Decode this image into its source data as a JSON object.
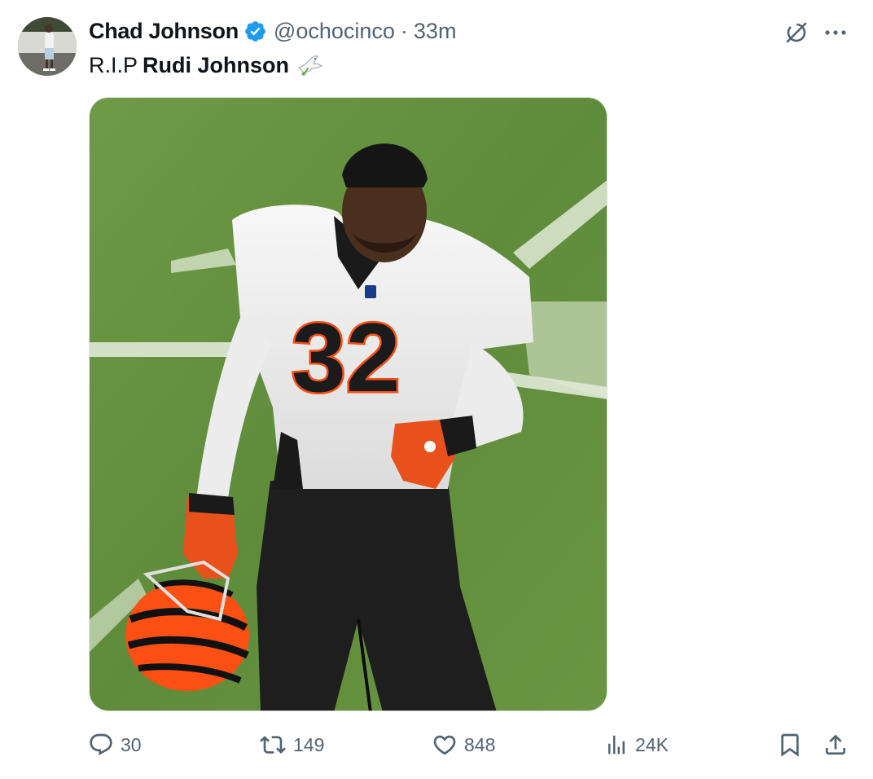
{
  "tweet": {
    "author": {
      "display_name": "Chad Johnson",
      "handle": "@ochocinco",
      "verified": true
    },
    "separator": "·",
    "timestamp": "33m",
    "text": {
      "prefix": "R.I.P",
      "bold": "Rudi Johnson",
      "emoji": "dove-emoji"
    },
    "media": {
      "type": "photo",
      "jersey_number": "32"
    },
    "header_icons": [
      "grok-icon",
      "more-icon"
    ]
  },
  "actions": {
    "replies": "30",
    "reposts": "149",
    "likes": "848",
    "views": "24K",
    "icons": [
      "reply-icon",
      "repost-icon",
      "like-icon",
      "views-icon",
      "bookmark-icon",
      "share-icon"
    ]
  },
  "colors": {
    "verified_blue": "#1d9bf0",
    "secondary_text": "#536471",
    "primary_text": "#0f1419",
    "bengals_orange": "#fb4f14"
  }
}
